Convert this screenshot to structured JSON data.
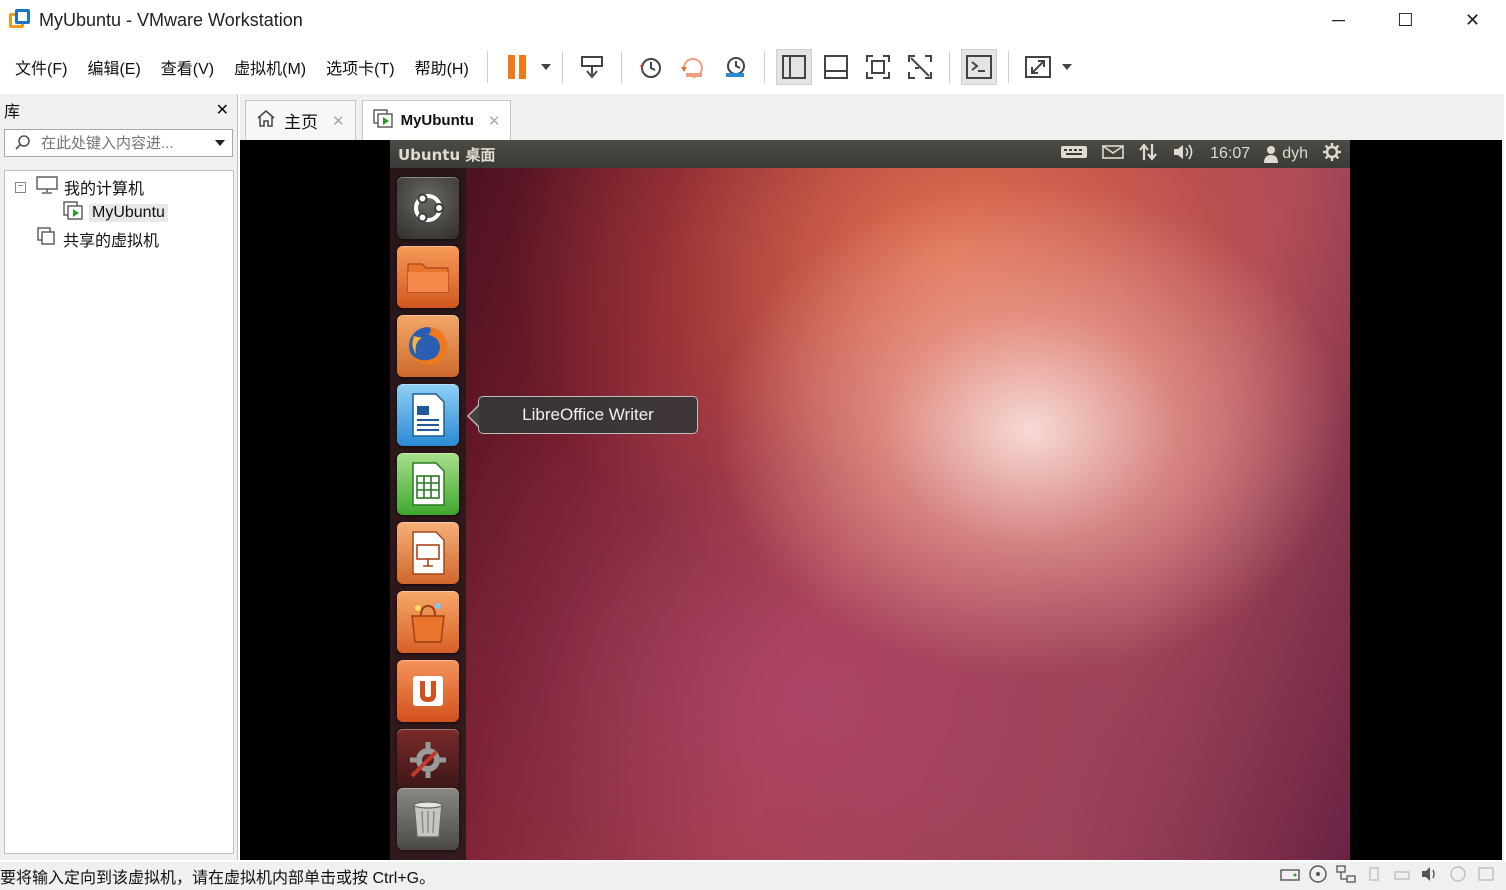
{
  "window": {
    "title": "MyUbuntu - VMware Workstation",
    "minimize": "─",
    "maximize": "☐",
    "close": "✕"
  },
  "menu": [
    "文件(F)",
    "编辑(E)",
    "查看(V)",
    "虚拟机(M)",
    "选项卡(T)",
    "帮助(H)"
  ],
  "library": {
    "title": "库",
    "close": "✕",
    "search_placeholder": "在此处键入内容进...",
    "tree": {
      "expander": "−",
      "my_computer": "我的计算机",
      "vm": "MyUbuntu",
      "shared": "共享的虚拟机"
    }
  },
  "tabs": [
    {
      "label": "主页",
      "close": "✕"
    },
    {
      "label": "MyUbuntu",
      "close": "✕"
    }
  ],
  "ubuntu": {
    "topbar_title": "Ubuntu 桌面",
    "time": "16:07",
    "user": "dyh",
    "tooltip": "LibreOffice Writer",
    "launcher_icons": [
      "dash-home",
      "files",
      "firefox",
      "libreoffice-writer",
      "libreoffice-calc",
      "libreoffice-impress",
      "software-center",
      "ubuntu-one",
      "system-settings",
      "trash"
    ]
  },
  "status": {
    "message": "要将输入定向到该虚拟机，请在虚拟机内部单击或按 Ctrl+G。"
  },
  "colors": {
    "accent_orange": "#f07a1a",
    "ubuntu_panel": "#3b3a36",
    "launcher_bg": "#231919"
  }
}
